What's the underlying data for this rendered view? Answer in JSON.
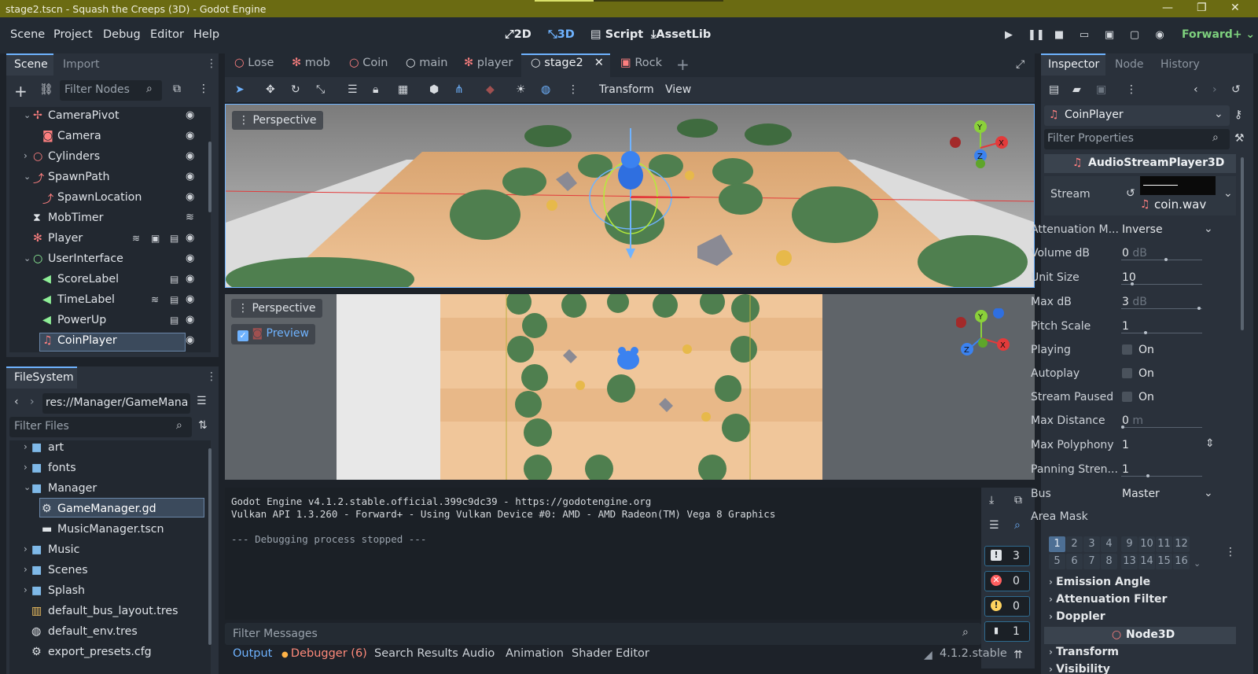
{
  "window": {
    "title": "stage2.tscn - Squash the Creeps (3D) - Godot Engine",
    "minimize": "—",
    "maximize": "❐",
    "close": "✕"
  },
  "menu": [
    "Scene",
    "Project",
    "Debug",
    "Editor",
    "Help"
  ],
  "modes": {
    "two_d": "2D",
    "three_d": "3D",
    "script": "Script",
    "assetlib": "AssetLib"
  },
  "renderer": "Forward+",
  "scene_dock": {
    "tab_scene": "Scene",
    "tab_import": "Import",
    "filter_placeholder": "Filter Nodes",
    "nodes": [
      {
        "label": "CameraPivot"
      },
      {
        "label": "Camera"
      },
      {
        "label": "Cylinders"
      },
      {
        "label": "SpawnPath"
      },
      {
        "label": "SpawnLocation"
      },
      {
        "label": "MobTimer"
      },
      {
        "label": "Player"
      },
      {
        "label": "UserInterface"
      },
      {
        "label": "ScoreLabel"
      },
      {
        "label": "TimeLabel"
      },
      {
        "label": "PowerUp"
      },
      {
        "label": "CoinPlayer"
      }
    ]
  },
  "filesystem": {
    "tab": "FileSystem",
    "path": "res://Manager/GameMana",
    "filter_placeholder": "Filter Files",
    "items": [
      {
        "label": "art"
      },
      {
        "label": "fonts"
      },
      {
        "label": "Manager"
      },
      {
        "label": "GameManager.gd"
      },
      {
        "label": "MusicManager.tscn"
      },
      {
        "label": "Music"
      },
      {
        "label": "Scenes"
      },
      {
        "label": "Splash"
      },
      {
        "label": "default_bus_layout.tres"
      },
      {
        "label": "default_env.tres"
      },
      {
        "label": "export_presets.cfg"
      }
    ]
  },
  "scene_tabs": [
    "Lose",
    "mob",
    "Coin",
    "main",
    "player",
    "stage2",
    "Rock"
  ],
  "toolbar": {
    "transform": "Transform",
    "view": "View"
  },
  "viewport": {
    "top_label": "Perspective",
    "bottom_label": "Perspective",
    "preview": "Preview"
  },
  "gizmo": {
    "x": "X",
    "y": "Y",
    "z": "Z"
  },
  "console": {
    "lines": [
      "Godot Engine v4.1.2.stable.official.399c9dc39 - https://godotengine.org",
      "Vulkan API 1.3.260 - Forward+ - Using Vulkan Device #0: AMD - AMD Radeon(TM) Vega 8 Graphics",
      "",
      "--- Debugging process stopped ---"
    ],
    "filter_placeholder": "Filter Messages",
    "counts": {
      "messages": "3",
      "errors": "0",
      "warnings": "0",
      "other": "1"
    }
  },
  "bottom_tabs": [
    "Output",
    "Debugger (6)",
    "Search Results",
    "Audio",
    "Animation",
    "Shader Editor"
  ],
  "version": "4.1.2.stable",
  "inspector": {
    "tabs": [
      "Inspector",
      "Node",
      "History"
    ],
    "node_name": "CoinPlayer",
    "filter_placeholder": "Filter Properties",
    "class": "AudioStreamPlayer3D",
    "stream_label": "Stream",
    "stream_file": "coin.wav",
    "props": [
      {
        "k": "Attenuation M...",
        "v": "Inverse"
      },
      {
        "k": "Volume dB",
        "v": "0",
        "u": "dB"
      },
      {
        "k": "Unit Size",
        "v": "10"
      },
      {
        "k": "Max dB",
        "v": "3",
        "u": "dB"
      },
      {
        "k": "Pitch Scale",
        "v": "1"
      },
      {
        "k": "Playing",
        "v": "On"
      },
      {
        "k": "Autoplay",
        "v": "On"
      },
      {
        "k": "Stream Paused",
        "v": "On"
      },
      {
        "k": "Max Distance",
        "v": "0",
        "u": "m"
      },
      {
        "k": "Max Polyphony",
        "v": "1"
      },
      {
        "k": "Panning Stren...",
        "v": "1"
      },
      {
        "k": "Bus",
        "v": "Master"
      },
      {
        "k": "Area Mask",
        "v": ""
      }
    ],
    "mask_top": [
      "1",
      "2",
      "3",
      "4",
      "9",
      "10",
      "11",
      "12"
    ],
    "mask_bottom": [
      "5",
      "6",
      "7",
      "8",
      "13",
      "14",
      "15",
      "16"
    ],
    "sections": [
      "Emission Angle",
      "Attenuation Filter",
      "Doppler"
    ],
    "node3d": "Node3D",
    "transform": "Transform",
    "visibility": "Visibility"
  },
  "colors": {
    "accent": "#6fb3ff",
    "title_bg": "#6b6b12",
    "panel": "#2a313b",
    "renderer": "#7ed17e"
  }
}
